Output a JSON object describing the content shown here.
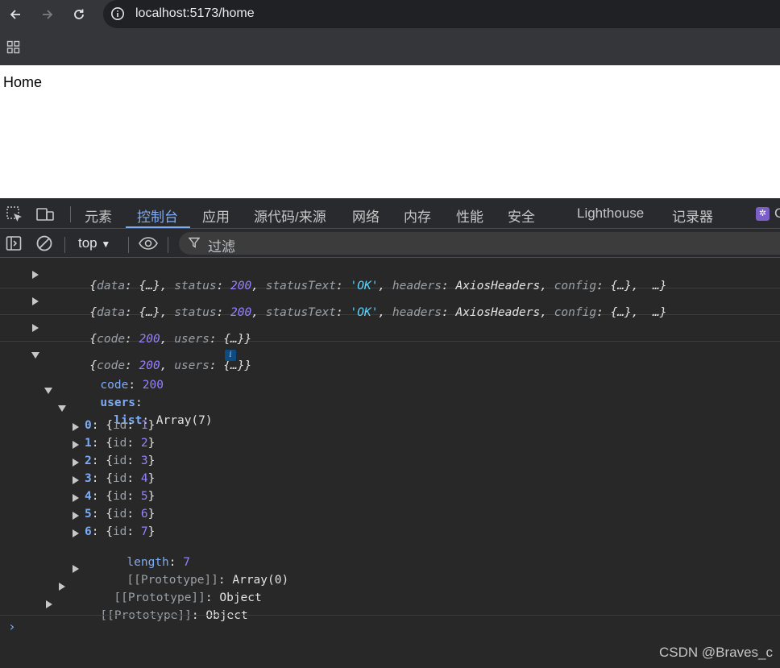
{
  "browser": {
    "url": "localhost:5173/home"
  },
  "page": {
    "text": "Home"
  },
  "devtools": {
    "tabs": [
      {
        "label": "元素"
      },
      {
        "label": "控制台"
      },
      {
        "label": "应用"
      },
      {
        "label": "源代码/来源"
      },
      {
        "label": "网络"
      },
      {
        "label": "内存"
      },
      {
        "label": "性能"
      },
      {
        "label": "安全"
      },
      {
        "label": "Lighthouse"
      },
      {
        "label": "记录器"
      }
    ],
    "active_tab": "控制台",
    "context": "top",
    "filter_placeholder": "过滤"
  },
  "console": {
    "rows": [
      {
        "k_data": "data",
        "data_val": "{…}",
        "k_status": "status",
        "status_val": "200",
        "k_statusText": "statusText",
        "statusText_val": "'OK'",
        "k_headers": "headers",
        "headers_val": "AxiosHeaders",
        "k_config": "config",
        "config_val": "{…}",
        "more": "…"
      },
      {
        "k_data": "data",
        "data_val": "{…}",
        "k_status": "status",
        "status_val": "200",
        "k_statusText": "statusText",
        "statusText_val": "'OK'",
        "k_headers": "headers",
        "headers_val": "AxiosHeaders",
        "k_config": "config",
        "config_val": "{…}",
        "more": "…"
      }
    ],
    "summary": {
      "k_code": "code",
      "code_val": "200",
      "k_users": "users",
      "users_val": "{…}"
    },
    "expanded": {
      "k_code": "code",
      "code_val": "200",
      "k_users": "users",
      "users_val": "{…}",
      "code_key": "code",
      "code_value": "200",
      "users_key": "users",
      "list_key": "list",
      "list_type": "Array(7)",
      "items": [
        {
          "index": "0",
          "id_key": "id",
          "id": "1"
        },
        {
          "index": "1",
          "id_key": "id",
          "id": "2"
        },
        {
          "index": "2",
          "id_key": "id",
          "id": "3"
        },
        {
          "index": "3",
          "id_key": "id",
          "id": "4"
        },
        {
          "index": "4",
          "id_key": "id",
          "id": "5"
        },
        {
          "index": "5",
          "id_key": "id",
          "id": "6"
        },
        {
          "index": "6",
          "id_key": "id",
          "id": "7"
        }
      ],
      "length_key": "length",
      "length_value": "7",
      "proto_key": "[[Prototype]]",
      "proto_array": "Array(0)",
      "proto_object": "Object",
      "info_badge": "i"
    },
    "prompt": "›"
  },
  "watermark": "CSDN @Braves_c",
  "colors": {
    "accent": "#7cacf8",
    "number": "#9980ff",
    "string": "#5cd5fb",
    "background": "#282828"
  }
}
